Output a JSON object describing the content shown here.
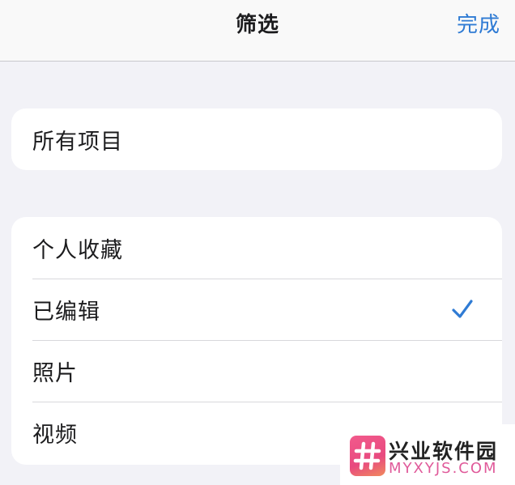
{
  "navbar": {
    "title": "筛选",
    "done_label": "完成"
  },
  "group1": {
    "items": [
      {
        "label": "所有项目",
        "checked": false
      }
    ]
  },
  "group2": {
    "items": [
      {
        "label": "个人收藏",
        "checked": false
      },
      {
        "label": "已编辑",
        "checked": true
      },
      {
        "label": "照片",
        "checked": false
      },
      {
        "label": "视频",
        "checked": false
      }
    ]
  },
  "watermark": {
    "title": "兴业软件园",
    "url": "MYXYJS.COM",
    "logo_icon": "hashtag-icon"
  },
  "colors": {
    "accent": "#2f7bd4",
    "background": "#f2f2f7",
    "card": "#ffffff",
    "separator": "#d8d8dc"
  }
}
